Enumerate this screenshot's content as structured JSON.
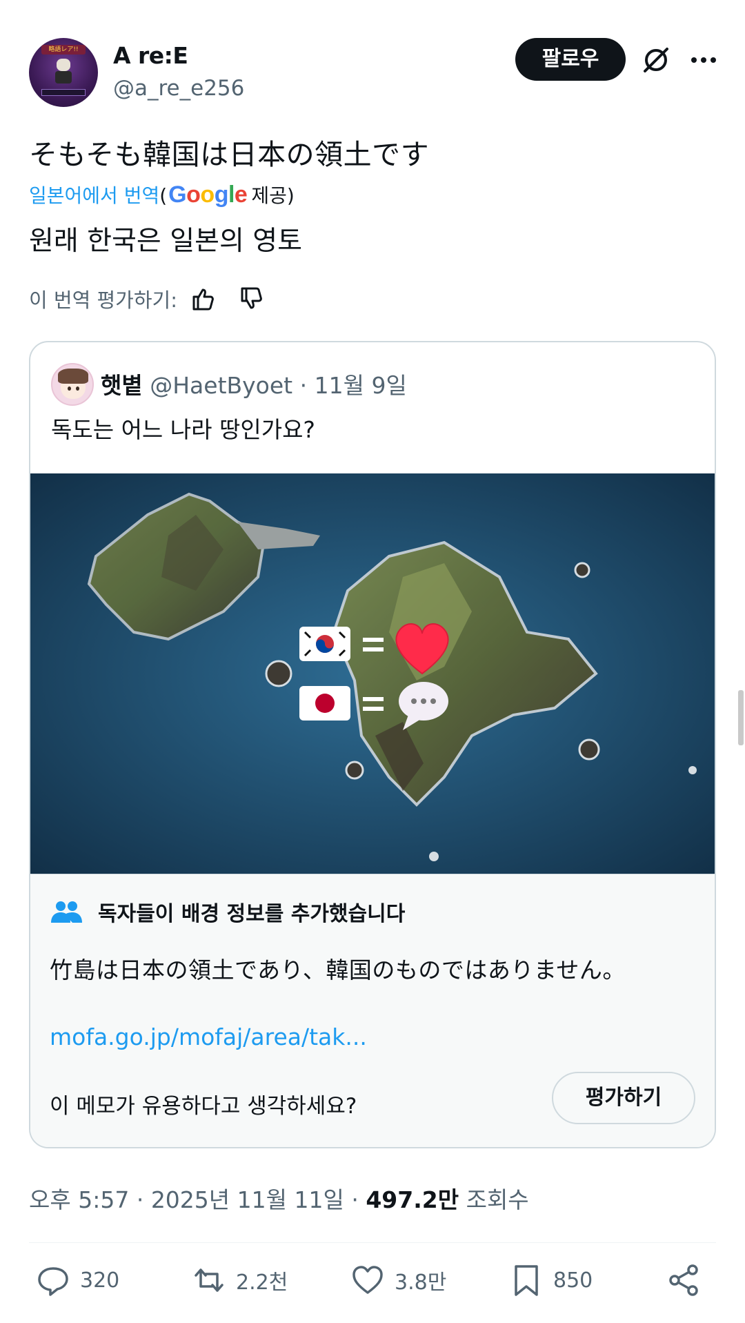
{
  "author": {
    "display_name": "A re:E",
    "handle": "@a_re_e256",
    "avatar_text": "略語レア!!"
  },
  "header": {
    "follow_label": "팔로우"
  },
  "post": {
    "text": "そもそも韓国は日本の領土です",
    "translation_prefix": "일본어에서 번역",
    "translation_open": "(",
    "translation_provider": "Google",
    "translation_suffix": "제공)",
    "translated_text": "원래 한국은 일본의 영토",
    "rate_translation_label": "이 번역 평가하기:"
  },
  "quote": {
    "name": "햇볕",
    "handle": "@HaetByoet",
    "date": "11월 9일",
    "text": "독도는 어느 나라 땅인가요?"
  },
  "community_note": {
    "title": "독자들이 배경 정보를 추가했습니다",
    "body": "竹島は日本の領土であり、韓国のものではありません。",
    "link": "mofa.go.jp/mofaj/area/tak...",
    "question": "이 메모가 유용하다고 생각하세요?",
    "rate_label": "평가하기"
  },
  "meta": {
    "time": "오후 5:57",
    "date": "2025년 11월 11일",
    "views": "497.2만",
    "views_label": "조회수"
  },
  "actions": {
    "replies": "320",
    "reposts": "2.2천",
    "likes": "3.8만",
    "bookmarks": "850"
  },
  "colors": {
    "accent": "#1d9bf0",
    "text": "#0f1419",
    "secondary": "#536471",
    "border": "#cfd9de"
  },
  "icons": [
    "grok-icon",
    "more-icon",
    "thumbs-up-icon",
    "thumbs-down-icon",
    "people-icon",
    "reply-icon",
    "repost-icon",
    "like-icon",
    "bookmark-icon",
    "share-icon",
    "korea-flag-icon",
    "japan-flag-icon",
    "heart-emoji-icon",
    "speech-bubble-icon"
  ]
}
